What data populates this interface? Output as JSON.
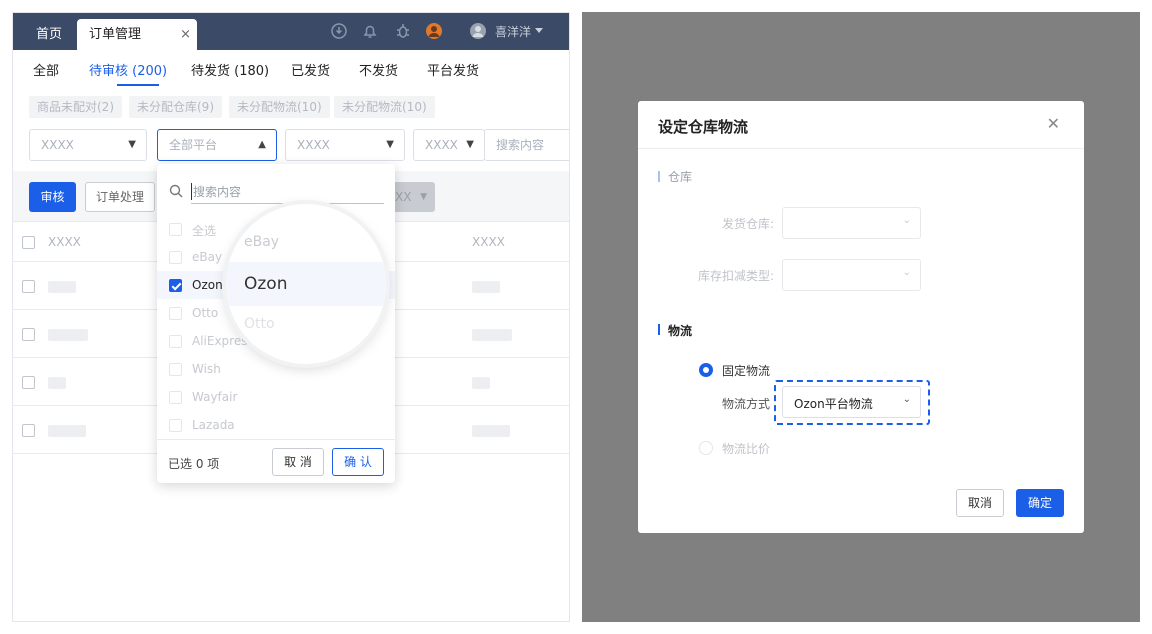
{
  "tabs": {
    "home": "首页",
    "active": "订单管理",
    "close": "×"
  },
  "user": {
    "name": "喜洋洋"
  },
  "status_tabs": [
    "全部",
    "待审核 (200)",
    "待发货 (180)",
    "已发货",
    "不发货",
    "平台发货"
  ],
  "filter_chips": [
    "商品未配对(2)",
    "未分配仓库(9)",
    "未分配物流(10)",
    "未分配物流(10)"
  ],
  "filters": {
    "select1": "XXXX",
    "platform": "全部平台",
    "select3": "XXXX",
    "select4": "XXXX",
    "search_placeholder": "搜索内容"
  },
  "actions": {
    "review": "审核",
    "process": "订单处理",
    "partial": "XX"
  },
  "table": {
    "col1": "XXXX",
    "col2": "XXXX"
  },
  "dropdown": {
    "search_placeholder": "搜索内容",
    "options": [
      "全选",
      "eBay",
      "Ozon",
      "Otto",
      "AliExpress",
      "Wish",
      "Wayfair",
      "Lazada"
    ],
    "checked": "Ozon",
    "selected_count": "已选 0 项",
    "cancel": "取 消",
    "confirm": "确 认"
  },
  "magnifier": {
    "above": "eBay",
    "focus": "Ozon",
    "below": "Otto"
  },
  "dialog": {
    "title": "设定仓库物流",
    "close": "✕",
    "section_warehouse": "仓库",
    "label_ship_warehouse": "发货仓库:",
    "label_stock_type": "库存扣减类型:",
    "section_logistics": "物流",
    "radio_fixed": "固定物流",
    "label_method": "物流方式",
    "method_value": "Ozon平台物流",
    "radio_ratio": "物流比价",
    "cancel": "取消",
    "confirm": "确定"
  },
  "colors": {
    "primary": "#1b5fe8",
    "topbar": "#3b4a66",
    "overlay": "#808080"
  }
}
